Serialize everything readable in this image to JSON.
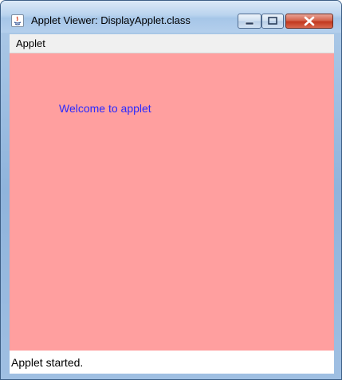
{
  "window": {
    "title": "Applet Viewer: DisplayApplet.class",
    "icon": "java-icon",
    "controls": {
      "minimize": "minimize-icon",
      "maximize": "maximize-icon",
      "close": "close-icon"
    }
  },
  "menubar": {
    "items": [
      {
        "label": "Applet"
      }
    ]
  },
  "applet": {
    "background_color": "#ff9f9f",
    "text": "Welcome to applet",
    "text_color": "#2a2aff"
  },
  "status": {
    "text": "Applet started."
  }
}
